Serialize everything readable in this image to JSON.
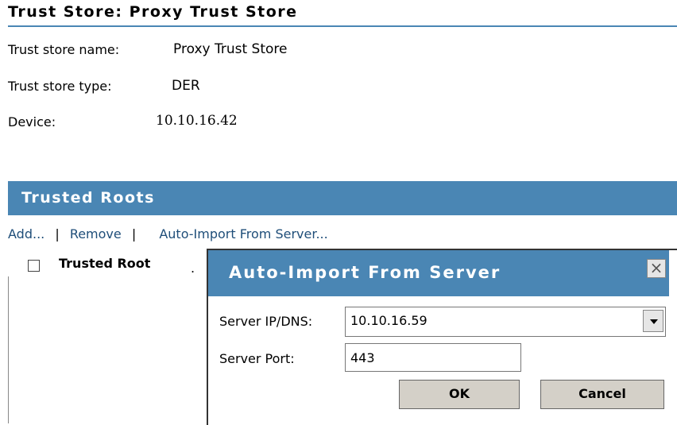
{
  "page": {
    "title": "Trust Store: Proxy Trust Store"
  },
  "details": {
    "name_label": "Trust store name:",
    "name_value": "Proxy Trust Store",
    "type_label": "Trust store type:",
    "type_value": "DER",
    "device_label": "Device:",
    "device_value": "10.10.16.42"
  },
  "trusted_roots": {
    "title": "Trusted Roots",
    "actions": {
      "add": "Add...",
      "separator": "|",
      "remove": "Remove",
      "auto_import": "Auto-Import From Server..."
    },
    "column_header": "Trusted Root",
    "column_dot": "."
  },
  "dialog": {
    "title": "Auto-Import From Server",
    "close_glyph": "×",
    "server_label": "Server IP/DNS:",
    "server_value": "10.10.16.59",
    "port_label": "Server Port:",
    "port_value": "443",
    "ok_label": "OK",
    "cancel_label": "Cancel"
  },
  "colors": {
    "header_blue": "#4a86b4",
    "link_blue": "#1f4e79",
    "button_gray": "#d4d0c8"
  },
  "icons": {
    "close": "close-icon",
    "dropdown": "chevron-down-icon"
  }
}
